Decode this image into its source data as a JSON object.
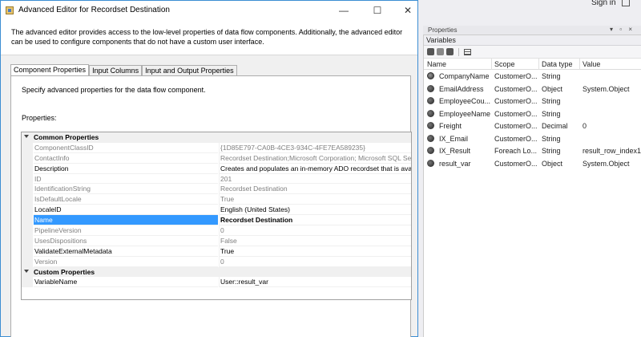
{
  "ide": {
    "signin_label": "Sign in",
    "properties_title": "Properties",
    "properties_controls": "▾ ▫ ×",
    "variables": {
      "title": "Variables",
      "columns": [
        "Name",
        "Scope",
        "Data type",
        "Value"
      ],
      "rows": [
        {
          "name": "CompanyName",
          "scope": "CustomerO...",
          "type": "String",
          "value": ""
        },
        {
          "name": "EmailAddress",
          "scope": "CustomerO...",
          "type": "Object",
          "value": "System.Object"
        },
        {
          "name": "EmployeeCou...",
          "scope": "CustomerO...",
          "type": "String",
          "value": ""
        },
        {
          "name": "EmployeeName",
          "scope": "CustomerO...",
          "type": "String",
          "value": ""
        },
        {
          "name": "Freight",
          "scope": "CustomerO...",
          "type": "Decimal",
          "value": "0"
        },
        {
          "name": "IX_Email",
          "scope": "CustomerO...",
          "type": "String",
          "value": ""
        },
        {
          "name": "IX_Result",
          "scope": "Foreach Lo...",
          "type": "String",
          "value": "result_row_index1"
        },
        {
          "name": "result_var",
          "scope": "CustomerO...",
          "type": "Object",
          "value": "System.Object"
        }
      ]
    }
  },
  "dialog": {
    "title": "Advanced Editor for Recordset Destination",
    "minimize": "—",
    "maximize": "☐",
    "close": "✕",
    "description": "The advanced editor provides access to the low-level properties of data flow components. Additionally, the advanced editor can be used to configure components that do not have a custom user interface.",
    "tabs": [
      {
        "label": "Component Properties",
        "active": true
      },
      {
        "label": "Input Columns",
        "active": false
      },
      {
        "label": "Input and Output Properties",
        "active": false
      }
    ],
    "page_description": "Specify advanced properties for the data flow component.",
    "properties_label": "Properties:",
    "grid": {
      "categories": [
        {
          "label": "Common Properties",
          "rows": [
            {
              "name": "ComponentClassID",
              "value": "{1D85E797-CA0B-4CE3-934C-4FE7EA589235}",
              "editable": false
            },
            {
              "name": "ContactInfo",
              "value": "Recordset Destination;Microsoft Corporation; Microsoft SQL Server",
              "editable": false
            },
            {
              "name": "Description",
              "value": "Creates and populates an in-memory ADO recordset that is available",
              "editable": true
            },
            {
              "name": "ID",
              "value": "201",
              "editable": false
            },
            {
              "name": "IdentificationString",
              "value": "Recordset Destination",
              "editable": false
            },
            {
              "name": "IsDefaultLocale",
              "value": "True",
              "editable": false
            },
            {
              "name": "LocaleID",
              "value": "English (United States)",
              "editable": true
            },
            {
              "name": "Name",
              "value": "Recordset Destination",
              "editable": true,
              "selected": true
            },
            {
              "name": "PipelineVersion",
              "value": "0",
              "editable": false
            },
            {
              "name": "UsesDispositions",
              "value": "False",
              "editable": false
            },
            {
              "name": "ValidateExternalMetadata",
              "value": "True",
              "editable": true
            },
            {
              "name": "Version",
              "value": "0",
              "editable": false
            }
          ]
        },
        {
          "label": "Custom Properties",
          "rows": [
            {
              "name": "VariableName",
              "value": "User::result_var",
              "editable": true
            }
          ]
        }
      ]
    }
  },
  "colors": {
    "selection": "#3399ff",
    "dialog_border": "#3c8ed3",
    "disabled_text": "#808080"
  }
}
